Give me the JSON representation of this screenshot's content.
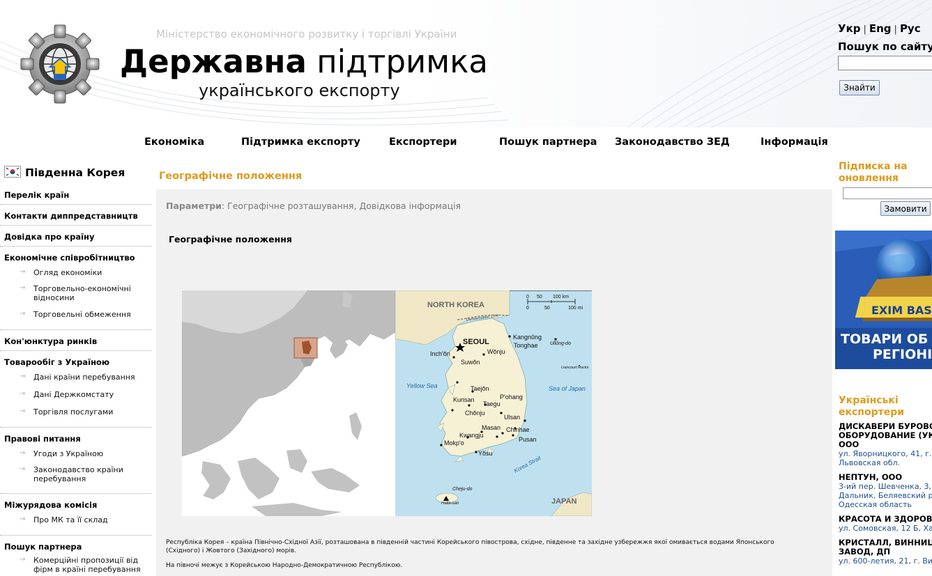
{
  "header": {
    "ministry": "Міністерство економічного розвитку і торгівлі України",
    "title_bold": "Державна",
    "title_rest": " підтримка",
    "subtitle": "українського експорту",
    "languages": [
      "Укр",
      "Eng",
      "Рус"
    ],
    "search_label": "Пошук по сайту",
    "search_value": "",
    "search_button": "Знайти"
  },
  "nav": [
    "Економіка",
    "Підтримка експорту",
    "Експортери",
    "Пошук партнера",
    "Законодавство ЗЕД",
    "Інформація"
  ],
  "sidebar": {
    "country": "Південна Корея",
    "sections": [
      {
        "label": "Перелік країн",
        "items": []
      },
      {
        "label": "Контакти диппредставництв",
        "items": []
      },
      {
        "label": "Довідка про країну",
        "items": []
      },
      {
        "label": "Економічне співробітництво",
        "items": [
          "Огляд економіки",
          "Торговельно-економічні відносини",
          "Торговельні обмеження"
        ]
      },
      {
        "label": "Кон'юнктура ринків",
        "items": []
      },
      {
        "label": "Товарообіг з Україною",
        "items": [
          "Дані країни перебування",
          "Дані Держкомстату",
          "Торгівля послугами"
        ]
      },
      {
        "label": "Правові питання",
        "items": [
          "Угоди з Україною",
          "Законодавство країни перебування"
        ]
      },
      {
        "label": "Міжурядова комісія",
        "items": [
          "Про МК та її склад"
        ]
      },
      {
        "label": "Пошук партнера",
        "items": [
          "Комерційні пропозиції від фірм в країні перебування"
        ]
      }
    ]
  },
  "main": {
    "title": "Географічне положення",
    "params_label": "Параметри",
    "params_value": ": Географічне розташування, Довідкова інформація",
    "section_title": "Географічне положення",
    "map_labels": {
      "north_korea": "NORTH KOREA",
      "demarcation": "Demarcation Line",
      "seoul": "SEOUL",
      "cities": [
        "Inch'ŏn",
        "Suwŏn",
        "Wŏnju",
        "Kangnŭng",
        "Tonghae",
        "Taejŏn",
        "Kunsan",
        "Chŏnju",
        "Taegu",
        "P'ohang",
        "Ulsan",
        "Masan",
        "Chinhae",
        "Kwangju",
        "Pusan",
        "Mokp'o",
        "Yŏsu",
        "Cheju-do",
        "Halla-san"
      ],
      "ulleung": "Ullŭng-do",
      "liancourt": "Liancourt Rocks",
      "yellow_sea": "Yellow Sea",
      "sea_of_japan": "Sea of Japan",
      "korea_strait": "Korea Strait",
      "japan": "JAPAN",
      "scale_km": [
        "0",
        "50",
        "100 km"
      ],
      "scale_mi": [
        "0",
        "50",
        "100 mi"
      ]
    },
    "paragraph1": "Республіка Корея – країна Північно-Східної Азії, розташована в південній частині Корейського півострова, східне, південне та західне узбережжя якої омивається водами Японського (Східного) і Жовтого (Західного) морів.",
    "paragraph2": "На півночі межує з Корейською Народно-Демократичною Республікою."
  },
  "right": {
    "subscribe_title_1": "Підписка на",
    "subscribe_title_2": "оновлення",
    "subscribe_value": "",
    "subscribe_button": "Замовити",
    "banner_logo": "EXIM BAS",
    "banner_line1": "ТОВАРИ ОБ",
    "banner_line2": "РЕГІОНІ",
    "exporters_title_1": "Українські",
    "exporters_title_2": "експортери",
    "exporters": [
      {
        "name": [
          "ДИСКАВЕРИ БУРОВОЕ",
          "ОБОРУДОВАНИЕ (УКР",
          "ООО"
        ],
        "address": [
          "ул. Яворницкого, 41, г.",
          "Львовская обл."
        ]
      },
      {
        "name": [
          "НЕПТУН, ООО"
        ],
        "address": [
          "3-ий пер. Шевченка, 3,",
          "Дальник, Беляевский р",
          "Одесская область"
        ]
      },
      {
        "name": [
          "КРАСОТА И ЗДОРОВЬ"
        ],
        "address": [
          "ул. Сомовская, 12 Б, Ха"
        ]
      },
      {
        "name": [
          "КРИСТАЛЛ, ВИННИЦ",
          "ЗАВОД, ДП"
        ],
        "address": [
          "ул. 600-летия, 21, г. Ви"
        ]
      }
    ]
  },
  "colors": {
    "accent": "#e09a1c",
    "link": "#1d4f8a",
    "content_bg": "#f1f1f1"
  }
}
